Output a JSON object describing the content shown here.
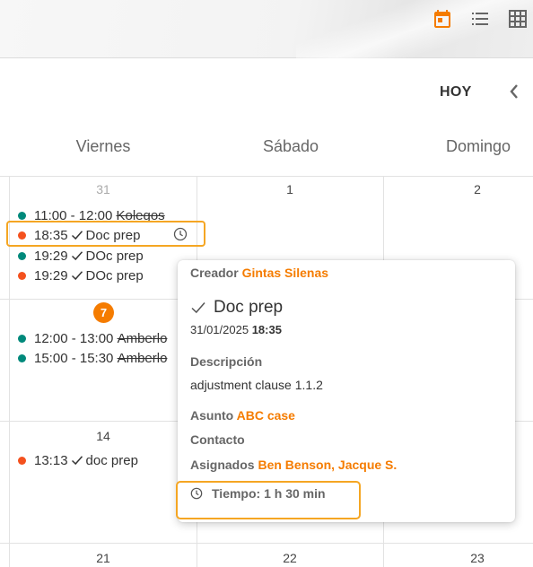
{
  "colors": {
    "accent": "#f57c00",
    "teal": "#00897b",
    "orange_dot": "#f4511e",
    "highlight": "#f5a623"
  },
  "topbar": {
    "icons": [
      "calendar-icon",
      "list-view-icon",
      "grid-view-icon"
    ]
  },
  "toolbar": {
    "today_label": "HOY",
    "prev_icon": "chevron-left-icon"
  },
  "days": [
    "Viernes",
    "Sábado",
    "Domingo"
  ],
  "weeks": [
    {
      "numbers": [
        "31",
        "1",
        "2"
      ],
      "events": [
        {
          "dot": "teal",
          "time": "11:00 - 12:00",
          "title": "Kolegos",
          "strike": true
        },
        {
          "dot": "orange",
          "time": "18:35",
          "title": "Doc prep",
          "check": true,
          "highlighted": true
        },
        {
          "dot": "teal",
          "time": "19:29",
          "title": "DOc prep",
          "check": true
        },
        {
          "dot": "orange",
          "time": "19:29",
          "title": "DOc prep",
          "check": true
        }
      ]
    },
    {
      "numbers": [
        "7"
      ],
      "events": [
        {
          "dot": "teal",
          "time": "12:00 - 13:00",
          "title": "Amberlo",
          "strike": true
        },
        {
          "dot": "teal",
          "time": "15:00 - 15:30",
          "title": "Amberlo",
          "strike": true
        }
      ]
    },
    {
      "numbers": [
        "14"
      ],
      "events": [
        {
          "dot": "orange",
          "time": "13:13",
          "title": "doc prep",
          "check": true
        }
      ]
    },
    {
      "numbers": [
        "21",
        "22",
        "23"
      ]
    }
  ],
  "popup": {
    "creator_label": "Creador",
    "creator_name": "Gintas Silenas",
    "title": "Doc prep",
    "date": "31/01/2025",
    "time": "18:35",
    "description_label": "Descripción",
    "description": "adjustment clause 1.1.2",
    "subject_label": "Asunto",
    "subject": "ABC case",
    "contact_label": "Contacto",
    "assigned_label": "Asignados",
    "assigned": "Ben Benson, Jacque S.",
    "duration": "Tiempo: 1 h 30 min"
  }
}
